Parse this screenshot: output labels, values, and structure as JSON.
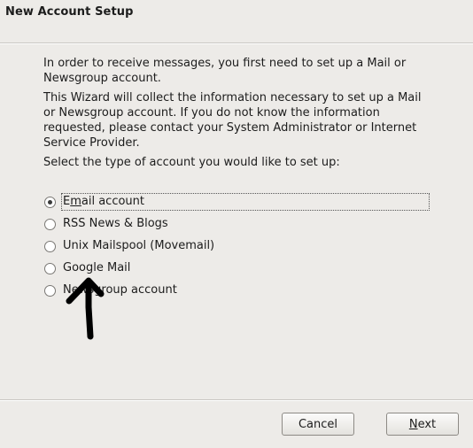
{
  "window": {
    "title": "New Account Setup"
  },
  "intro": {
    "paragraph1": "In order to receive messages, you first need to set up a Mail or Newsgroup account.",
    "paragraph2": "This Wizard will collect the information necessary to set up a Mail or Newsgroup account. If you do not know the information requested, please contact your System Administrator or Internet Service Provider.",
    "prompt": "Select the type of account you would like to set up:"
  },
  "account_types": {
    "selected": "Email account",
    "options": [
      {
        "pre": "E",
        "mnemonic": "m",
        "post": "ail account",
        "checked": true
      },
      {
        "label": "RSS News & Blogs",
        "checked": false
      },
      {
        "label": "Unix Mailspool (Movemail)",
        "checked": false
      },
      {
        "label": "Google Mail",
        "checked": false
      },
      {
        "label": "Newsgroup account",
        "checked": false
      }
    ]
  },
  "buttons": {
    "cancel": "Cancel",
    "next_mnemonic": "N",
    "next_rest": "ext"
  },
  "annotation": {
    "icon": "hand-drawn-arrow-up-icon",
    "color": "#000000"
  }
}
